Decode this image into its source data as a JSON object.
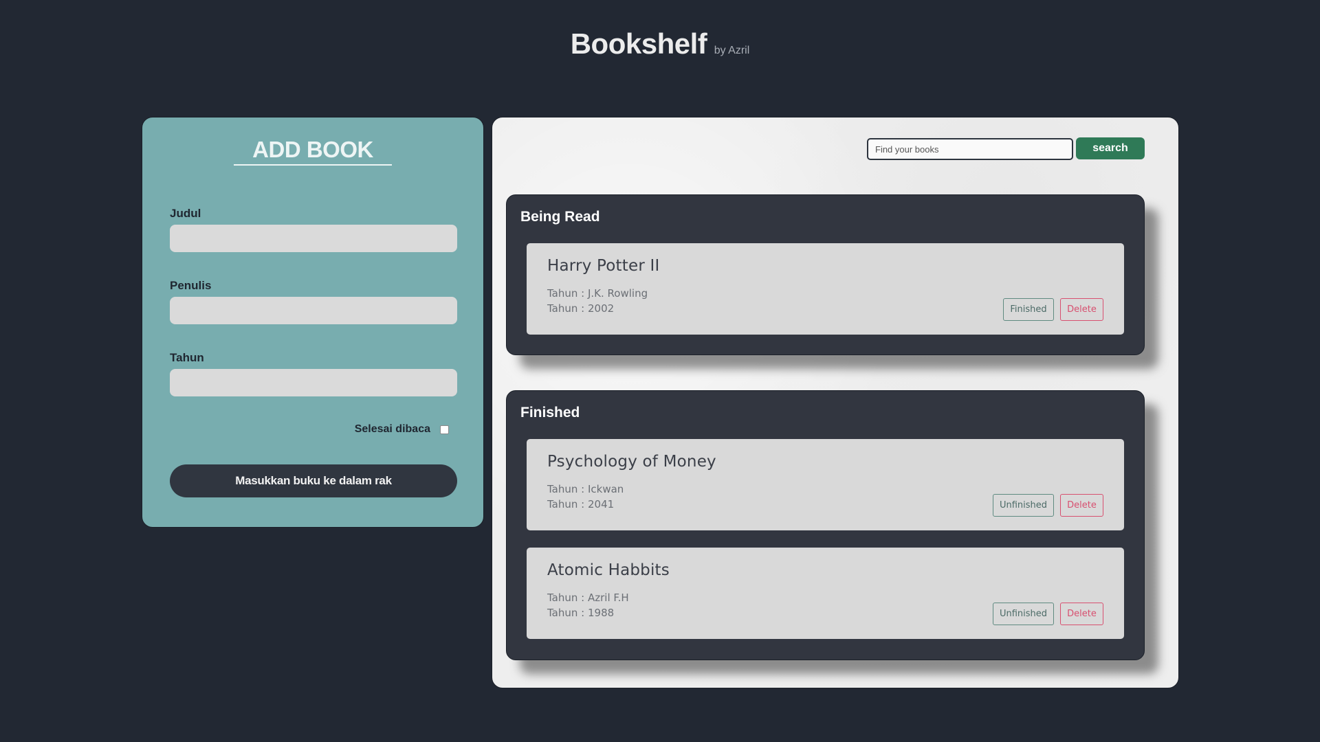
{
  "header": {
    "title": "Bookshelf",
    "subtitle": "by Azril"
  },
  "add_book": {
    "title": "ADD BOOK",
    "fields": [
      {
        "label": "Judul",
        "value": ""
      },
      {
        "label": "Penulis",
        "value": ""
      },
      {
        "label": "Tahun",
        "value": ""
      }
    ],
    "checkbox_label": "Selesai dibaca",
    "checkbox_checked": false,
    "submit_label": "Masukkan buku ke dalam rak"
  },
  "search": {
    "placeholder": "Find your books",
    "button_label": "search"
  },
  "shelves": {
    "reading": {
      "title": "Being Read",
      "books": [
        {
          "title": "Harry Potter II",
          "author_line": "Tahun : J.K. Rowling",
          "year_line": "Tahun : 2002",
          "status_button": "Finished",
          "delete_button": "Delete"
        }
      ]
    },
    "finished": {
      "title": "Finished",
      "books": [
        {
          "title": "Psychology of Money",
          "author_line": "Tahun : Ickwan",
          "year_line": "Tahun : 2041",
          "status_button": "Unfinished",
          "delete_button": "Delete"
        },
        {
          "title": "Atomic Habbits",
          "author_line": "Tahun : Azril F.H",
          "year_line": "Tahun : 1988",
          "status_button": "Unfinished",
          "delete_button": "Delete"
        }
      ]
    }
  },
  "colors": {
    "background": "#222833",
    "add_panel": "#78adaf",
    "shelf": "#323640",
    "card": "#d9d9d9",
    "search_button": "#2f7a57",
    "delete": "#d84f6f"
  }
}
